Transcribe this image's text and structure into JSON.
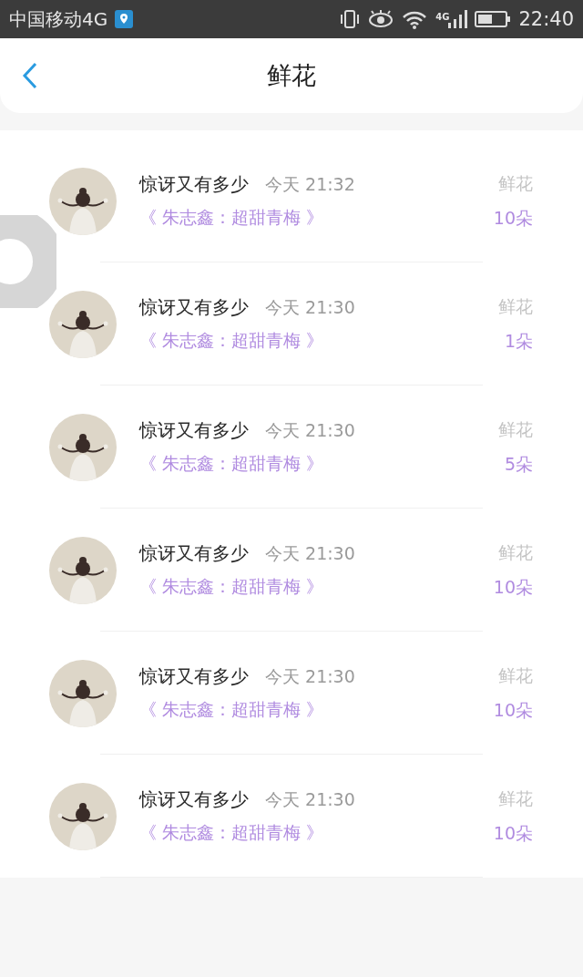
{
  "status_bar": {
    "carrier": "中国移动4G",
    "network": "4G",
    "time": "22:40"
  },
  "header": {
    "title": "鲜花"
  },
  "items": [
    {
      "name": "惊讶又有多少",
      "time": "今天 21:32",
      "work": "《 朱志鑫：超甜青梅 》",
      "gift": "鲜花",
      "count": "10朵"
    },
    {
      "name": "惊讶又有多少",
      "time": "今天 21:30",
      "work": "《 朱志鑫：超甜青梅 》",
      "gift": "鲜花",
      "count": "1朵"
    },
    {
      "name": "惊讶又有多少",
      "time": "今天 21:30",
      "work": "《 朱志鑫：超甜青梅 》",
      "gift": "鲜花",
      "count": "5朵"
    },
    {
      "name": "惊讶又有多少",
      "time": "今天 21:30",
      "work": "《 朱志鑫：超甜青梅 》",
      "gift": "鲜花",
      "count": "10朵"
    },
    {
      "name": "惊讶又有多少",
      "time": "今天 21:30",
      "work": "《 朱志鑫：超甜青梅 》",
      "gift": "鲜花",
      "count": "10朵"
    },
    {
      "name": "惊讶又有多少",
      "time": "今天 21:30",
      "work": "《 朱志鑫：超甜青梅 》",
      "gift": "鲜花",
      "count": "10朵"
    }
  ]
}
